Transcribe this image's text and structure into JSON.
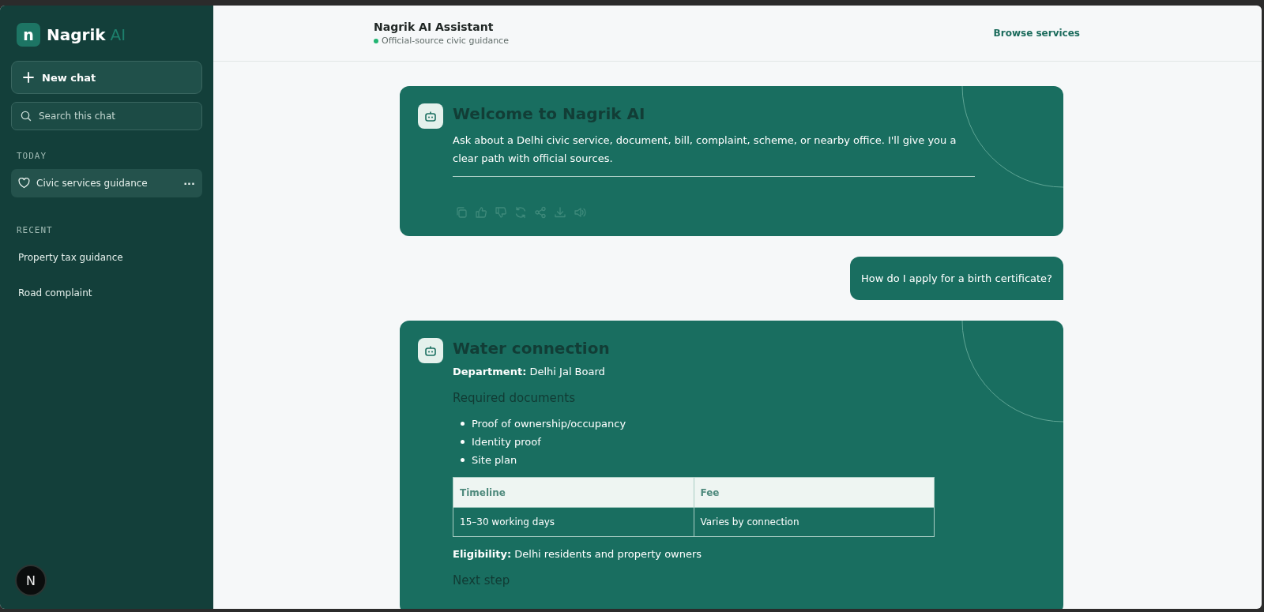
{
  "sidebar": {
    "logo": {
      "mark": "n",
      "name": "Nagrik",
      "suffix": "AI"
    },
    "new_chat": "New chat",
    "search": {
      "placeholder": "Search this chat"
    },
    "sections": [
      {
        "heading": "TODAY",
        "items": [
          {
            "label": "Civic services guidance",
            "selected": true,
            "menu": "···"
          }
        ]
      },
      {
        "heading": "RECENT",
        "items": [
          {
            "label": "Property tax guidance",
            "selected": false
          },
          {
            "label": "Road complaint",
            "selected": false
          }
        ]
      }
    ],
    "dev_badge": "N"
  },
  "header": {
    "title": "Nagrik AI Assistant",
    "status": "Official-source civic guidance",
    "link": "Browse services"
  },
  "messages": [
    {
      "kind": "welcome",
      "title": "Welcome to Nagrik AI",
      "text": "Ask about a Delhi civic service, document, bill, complaint, scheme, or nearby office. I'll give you a clear path with official sources.",
      "actions": [
        {
          "kind": "copy"
        },
        {
          "kind": "like"
        },
        {
          "kind": "dislike"
        },
        {
          "kind": "retry"
        },
        {
          "kind": "share"
        },
        {
          "kind": "download"
        },
        {
          "kind": "speak"
        }
      ]
    },
    {
      "kind": "user",
      "text": "How do I apply for a birth certificate?"
    },
    {
      "kind": "answer",
      "title": "Water connection",
      "blocks": [
        {
          "kind": "field",
          "label": "Department:",
          "value": "Delhi Jal Board"
        },
        {
          "kind": "heading",
          "text": "Required documents"
        },
        {
          "kind": "list",
          "items": [
            "Proof of ownership/occupancy",
            "Identity proof",
            "Site plan"
          ]
        },
        {
          "kind": "table",
          "columns": [
            "Timeline",
            "Fee"
          ],
          "rows": [
            [
              "15–30 working days",
              "Varies by connection"
            ]
          ]
        },
        {
          "kind": "field",
          "label": "Eligibility:",
          "value": "Delhi residents and property owners"
        },
        {
          "kind": "heading",
          "text": "Next step"
        }
      ]
    }
  ]
}
